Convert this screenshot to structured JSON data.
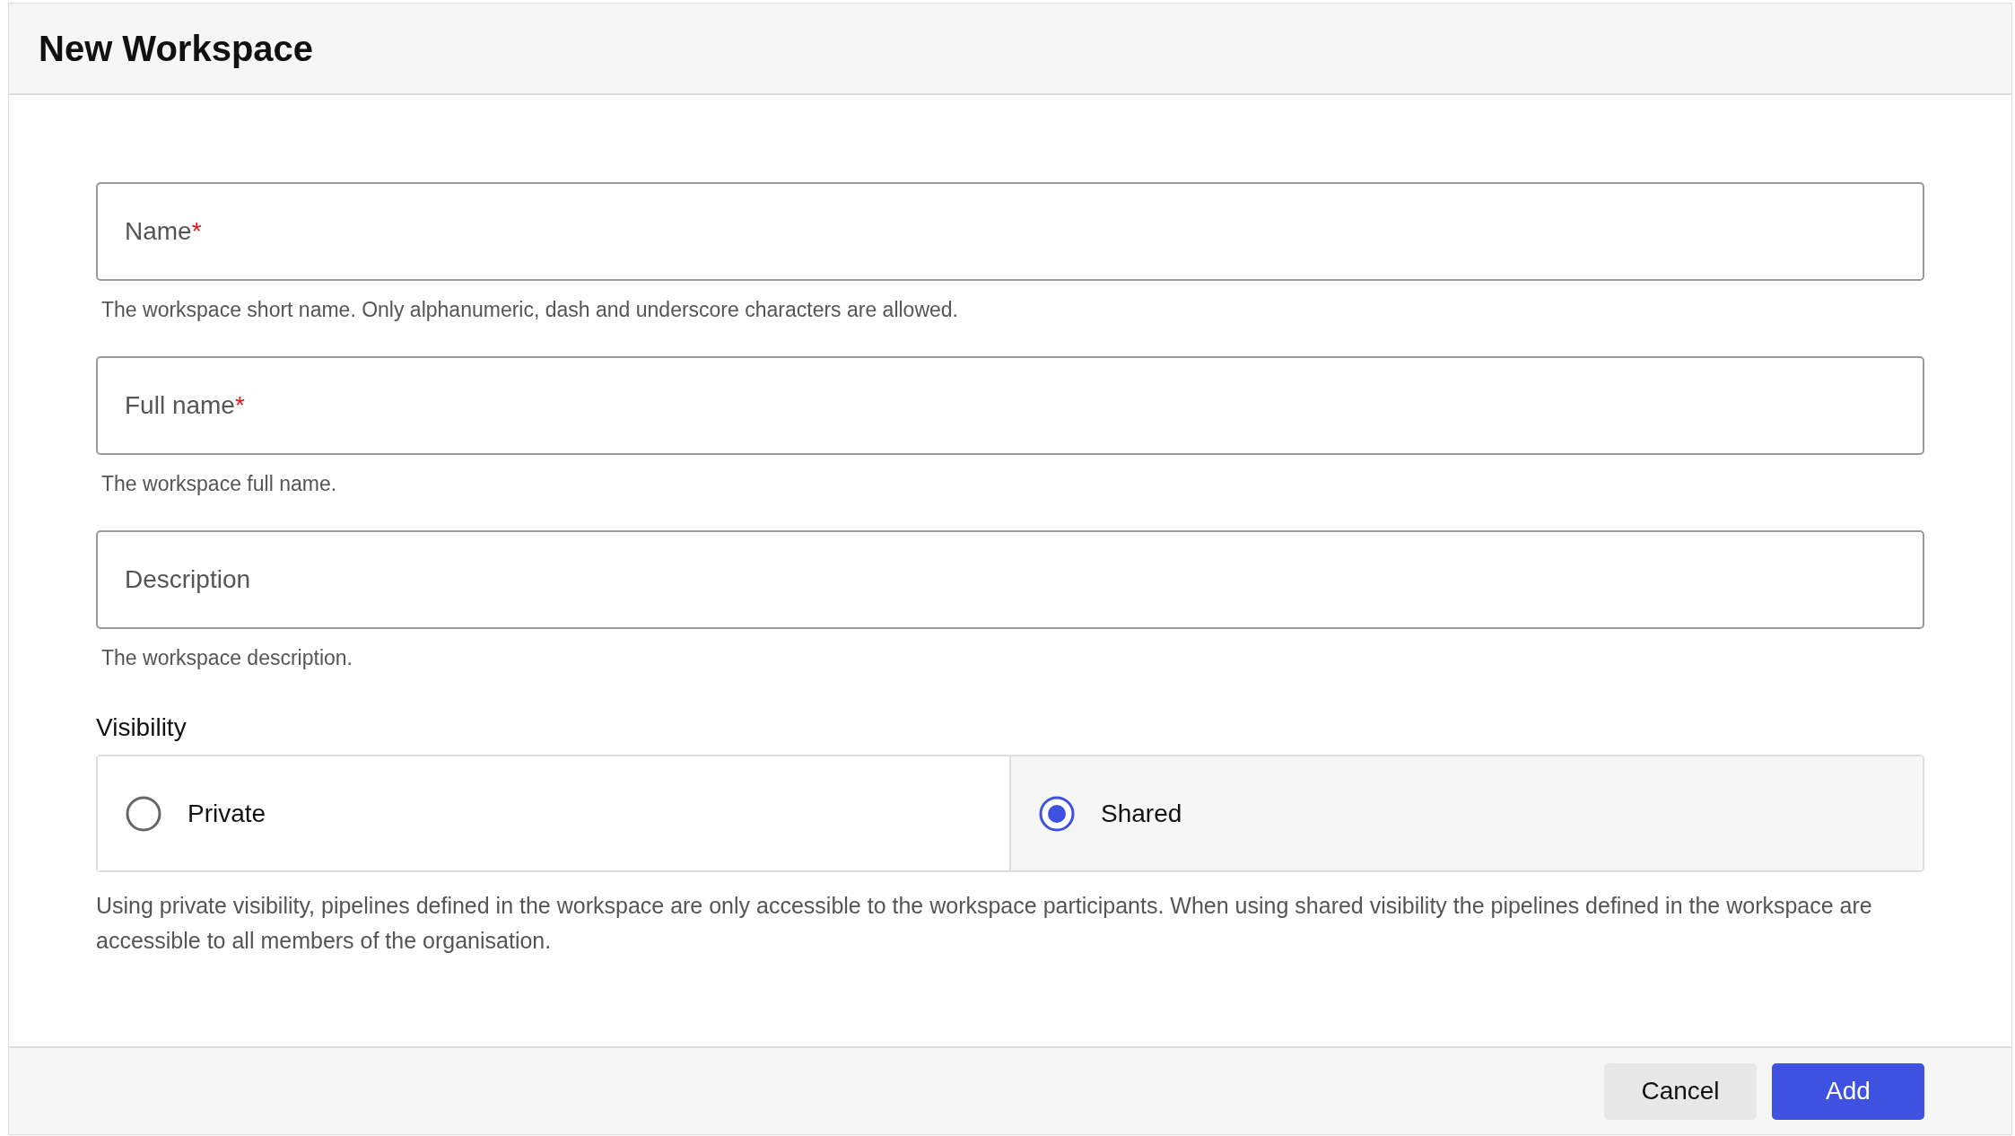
{
  "dialog": {
    "title": "New Workspace"
  },
  "fields": [
    {
      "label": "Name",
      "required_mark": "*",
      "help": "The workspace short name. Only alphanumeric, dash and underscore characters are allowed."
    },
    {
      "label": "Full name",
      "required_mark": "*",
      "help": "The workspace full name."
    },
    {
      "label": "Description",
      "help": "The workspace description."
    }
  ],
  "visibility": {
    "label": "Visibility",
    "options": [
      {
        "label": "Private",
        "selected": false
      },
      {
        "label": "Shared",
        "selected": true
      }
    ],
    "help": "Using private visibility, pipelines defined in the workspace are only accessible to the workspace participants. When using shared visibility the pipelines defined in the workspace are accessible to all members of the organisation."
  },
  "buttons": [
    {
      "label": "Cancel",
      "kind": "secondary"
    },
    {
      "label": "Add",
      "kind": "primary"
    }
  ]
}
